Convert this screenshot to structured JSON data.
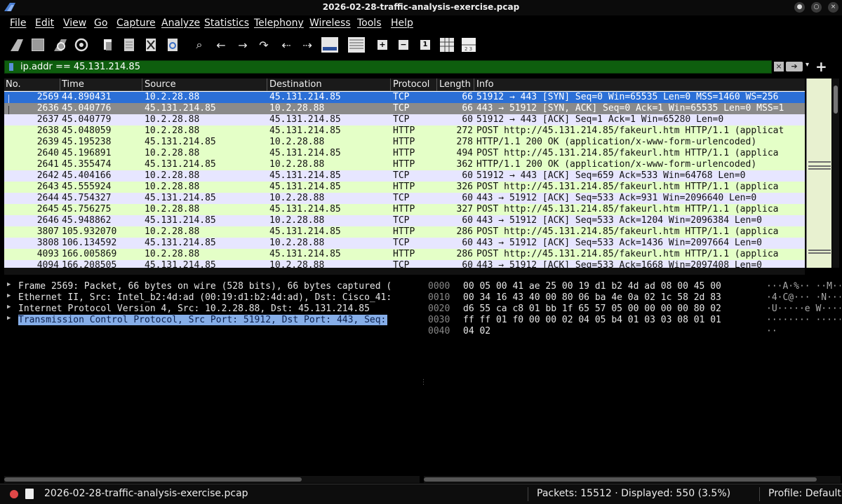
{
  "window": {
    "title": "2026-02-28-traffic-analysis-exercise.pcap"
  },
  "menu": [
    "File",
    "Edit",
    "View",
    "Go",
    "Capture",
    "Analyze",
    "Statistics",
    "Telephony",
    "Wireless",
    "Tools",
    "Help"
  ],
  "toolbar": {
    "icons": [
      "shark-fin-start-icon",
      "stop-capture-icon",
      "restart-capture-icon",
      "capture-options-icon",
      "open-file-icon",
      "save-file-icon",
      "close-file-icon",
      "reload-file-icon",
      "find-packet-icon",
      "go-back-icon",
      "go-forward-icon",
      "go-to-packet-icon",
      "first-packet-icon",
      "last-packet-icon",
      "auto-scroll-icon",
      "colorize-icon",
      "zoom-in-icon",
      "zoom-out-icon",
      "normal-size-icon",
      "resize-columns-icon",
      "layout-icon"
    ]
  },
  "filter": {
    "value": "ip.addr == 45.131.214.85",
    "add_label": "+"
  },
  "packet_list": {
    "columns": [
      "No.",
      "Time",
      "Source",
      "Destination",
      "Protocol",
      "Length",
      "Info"
    ],
    "rows": [
      {
        "no": "2569",
        "time": "44.890431",
        "src": "10.2.28.88",
        "dst": "45.131.214.85",
        "proto": "TCP",
        "len": "66",
        "info": "51912 → 443 [SYN] Seq=0 Win=65535 Len=0 MSS=1460 WS=256",
        "state": "selected"
      },
      {
        "no": "2636",
        "time": "45.040776",
        "src": "45.131.214.85",
        "dst": "10.2.28.88",
        "proto": "TCP",
        "len": "66",
        "info": "443 → 51912 [SYN, ACK] Seq=0 Ack=1 Win=65535 Len=0 MSS=1",
        "state": "related"
      },
      {
        "no": "2637",
        "time": "45.040779",
        "src": "10.2.28.88",
        "dst": "45.131.214.85",
        "proto": "TCP",
        "len": "60",
        "info": "51912 → 443 [ACK] Seq=1 Ack=1 Win=65280 Len=0",
        "state": "tcp"
      },
      {
        "no": "2638",
        "time": "45.048059",
        "src": "10.2.28.88",
        "dst": "45.131.214.85",
        "proto": "HTTP",
        "len": "272",
        "info": "POST http://45.131.214.85/fakeurl.htm HTTP/1.1  (applicat",
        "state": "http"
      },
      {
        "no": "2639",
        "time": "45.195238",
        "src": "45.131.214.85",
        "dst": "10.2.28.88",
        "proto": "HTTP",
        "len": "278",
        "info": "HTTP/1.1 200 OK  (application/x-www-form-urlencoded)",
        "state": "http"
      },
      {
        "no": "2640",
        "time": "45.196891",
        "src": "10.2.28.88",
        "dst": "45.131.214.85",
        "proto": "HTTP",
        "len": "494",
        "info": "POST http://45.131.214.85/fakeurl.htm HTTP/1.1  (applica",
        "state": "http"
      },
      {
        "no": "2641",
        "time": "45.355474",
        "src": "45.131.214.85",
        "dst": "10.2.28.88",
        "proto": "HTTP",
        "len": "362",
        "info": "HTTP/1.1 200 OK  (application/x-www-form-urlencoded)",
        "state": "http"
      },
      {
        "no": "2642",
        "time": "45.404166",
        "src": "10.2.28.88",
        "dst": "45.131.214.85",
        "proto": "TCP",
        "len": "60",
        "info": "51912 → 443 [ACK] Seq=659 Ack=533 Win=64768 Len=0",
        "state": "tcp"
      },
      {
        "no": "2643",
        "time": "45.555924",
        "src": "10.2.28.88",
        "dst": "45.131.214.85",
        "proto": "HTTP",
        "len": "326",
        "info": "POST http://45.131.214.85/fakeurl.htm HTTP/1.1  (applica",
        "state": "http"
      },
      {
        "no": "2644",
        "time": "45.754327",
        "src": "45.131.214.85",
        "dst": "10.2.28.88",
        "proto": "TCP",
        "len": "60",
        "info": "443 → 51912 [ACK] Seq=533 Ack=931 Win=2096640 Len=0",
        "state": "tcp"
      },
      {
        "no": "2645",
        "time": "45.756275",
        "src": "10.2.28.88",
        "dst": "45.131.214.85",
        "proto": "HTTP",
        "len": "327",
        "info": "POST http://45.131.214.85/fakeurl.htm HTTP/1.1  (applica",
        "state": "http"
      },
      {
        "no": "2646",
        "time": "45.948862",
        "src": "45.131.214.85",
        "dst": "10.2.28.88",
        "proto": "TCP",
        "len": "60",
        "info": "443 → 51912 [ACK] Seq=533 Ack=1204 Win=2096384 Len=0",
        "state": "tcp"
      },
      {
        "no": "3807",
        "time": "105.932070",
        "src": "10.2.28.88",
        "dst": "45.131.214.85",
        "proto": "HTTP",
        "len": "286",
        "info": "POST http://45.131.214.85/fakeurl.htm HTTP/1.1  (applica",
        "state": "http"
      },
      {
        "no": "3808",
        "time": "106.134592",
        "src": "45.131.214.85",
        "dst": "10.2.28.88",
        "proto": "TCP",
        "len": "60",
        "info": "443 → 51912 [ACK] Seq=533 Ack=1436 Win=2097664 Len=0",
        "state": "tcp"
      },
      {
        "no": "4093",
        "time": "166.005869",
        "src": "10.2.28.88",
        "dst": "45.131.214.85",
        "proto": "HTTP",
        "len": "286",
        "info": "POST http://45.131.214.85/fakeurl.htm HTTP/1.1  (applica",
        "state": "http"
      },
      {
        "no": "4094",
        "time": "166.208505",
        "src": "45.131.214.85",
        "dst": "10.2.28.88",
        "proto": "TCP",
        "len": "60",
        "info": "443 → 51912 [ACK] Seq=533 Ack=1668 Win=2097408 Len=0",
        "state": "tcp"
      }
    ]
  },
  "details": [
    {
      "text": "Frame 2569: Packet, 66 bytes on wire (528 bits), 66 bytes captured (",
      "selected": false
    },
    {
      "text": "Ethernet II, Src: Intel_b2:4d:ad (00:19:d1:b2:4d:ad), Dst: Cisco_41:",
      "selected": false
    },
    {
      "text": "Internet Protocol Version 4, Src: 10.2.28.88, Dst: 45.131.214.85",
      "selected": false
    },
    {
      "text": "Transmission Control Protocol, Src Port: 51912, Dst Port: 443, Seq:",
      "selected": true
    }
  ],
  "bytes": [
    {
      "offset": "0000",
      "hex": "00 05 00 41 ae 25 00 19  d1 b2 4d ad 08 00 45 00",
      "ascii": "···A·%·· ··M···E·"
    },
    {
      "offset": "0010",
      "hex": "00 34 16 43 40 00 80 06  ba 4e 0a 02 1c 58 2d 83",
      "ascii": "·4·C@··· ·N···X-·"
    },
    {
      "offset": "0020",
      "hex": "d6 55 ca c8 01 bb 1f 65  57 05 00 00 00 00 80 02",
      "ascii": "·U·····e W·······"
    },
    {
      "offset": "0030",
      "hex": "ff ff 01 f0 00 00 02 04  05 b4 01 03 03 08 01 01",
      "ascii": "········ ········"
    },
    {
      "offset": "0040",
      "hex": "04 02",
      "ascii": "··"
    }
  ],
  "status": {
    "file": "2026-02-28-traffic-analysis-exercise.pcap",
    "packets": "Packets: 15512 · Displayed: 550 (3.5%)",
    "profile": "Profile: Default"
  },
  "colors": {
    "selected_row": "#2b6fd6",
    "related_row": "#8a8a8a",
    "tcp_row": "#e7e6ff",
    "http_row": "#e4ffc7",
    "filter_valid": "#0e5e0e"
  }
}
